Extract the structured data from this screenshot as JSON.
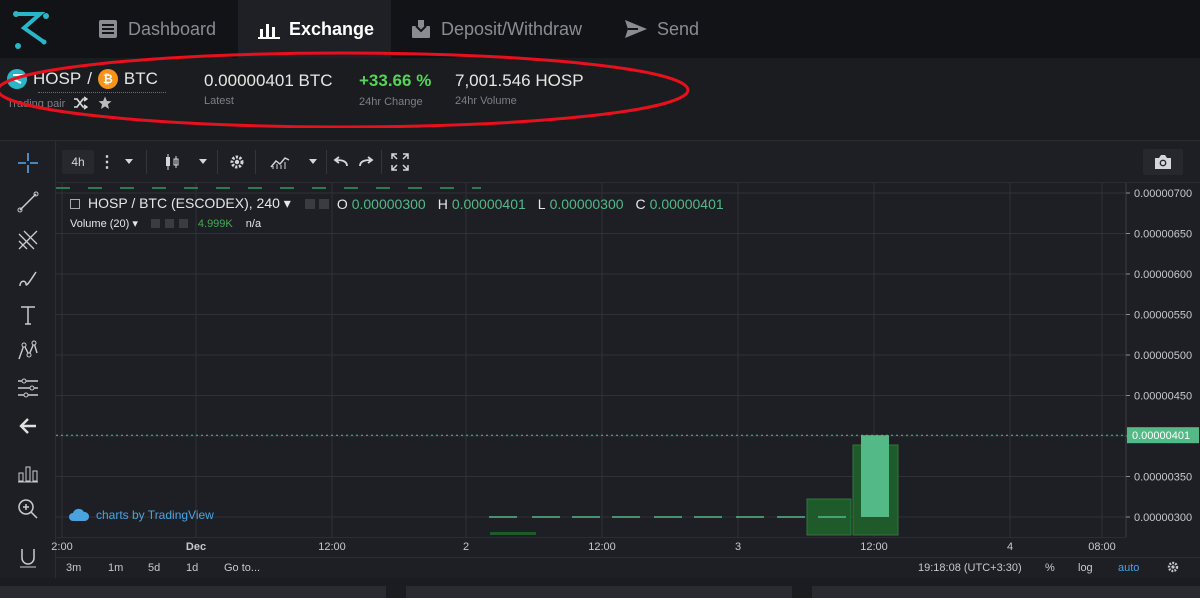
{
  "nav": {
    "items": [
      {
        "label": "Dashboard",
        "icon": "dashboard-icon"
      },
      {
        "label": "Exchange",
        "icon": "bar-chart-icon",
        "active": true
      },
      {
        "label": "Deposit/Withdraw",
        "icon": "wallet-icon"
      },
      {
        "label": "Send",
        "icon": "paper-plane-icon"
      }
    ]
  },
  "pair": {
    "base": "HOSP",
    "slash": "/",
    "quote": "BTC",
    "label": "Trading pair",
    "latest": "0.00000401 BTC",
    "latest_label": "Latest",
    "change": "+33.66 %",
    "change_label": "24hr Change",
    "volume": "7,001.546 HOSP",
    "volume_label": "24hr Volume",
    "quote_icon_glyph": "₿"
  },
  "toolbar": {
    "interval": "4h",
    "more": "⋮"
  },
  "chart_header": {
    "symbol": "HOSP / BTC (ESCODEX), 240 ▾",
    "o_label": "O",
    "o_value": "0.00000300",
    "h_label": "H",
    "h_value": "0.00000401",
    "l_label": "L",
    "l_value": "0.00000300",
    "c_label": "C",
    "c_value": "0.00000401",
    "volume_label": "Volume (20) ▾",
    "volume_value": "4.999K",
    "volume_na": "n/a",
    "watermark": "charts by TradingView"
  },
  "chart_data": {
    "type": "candlestick",
    "y_ticks": [
      "0.00000700",
      "0.00000650",
      "0.00000600",
      "0.00000550",
      "0.00000500",
      "0.00000450",
      "0.00000400",
      "0.00000350",
      "0.00000300"
    ],
    "ylim": [
      2.85e-06,
      7.1e-06
    ],
    "last_price_label": "0.00000401",
    "last_price": 4.01e-06,
    "x_ticks": [
      "2:00",
      "Dec",
      "12:00",
      "2",
      "12:00",
      "3",
      "12:00",
      "4",
      "08:00"
    ],
    "candles_flat_value": 3e-06,
    "big_candle": {
      "open": 3e-06,
      "high": 4.01e-06,
      "low": 3e-06,
      "close": 4.01e-06
    },
    "colors": {
      "up": "#53b987",
      "grid": "#2f3138",
      "volume": "#1f5a2a"
    }
  },
  "bottom": {
    "ranges": [
      "3m",
      "1m",
      "5d",
      "1d",
      "Go to..."
    ],
    "time": "19:18:08 (UTC+3:30)",
    "pct": "%",
    "log": "log",
    "auto": "auto"
  },
  "colors": {
    "accent_green": "#56d356",
    "accent_red": "#e8101c",
    "btc_orange": "#f7931a",
    "hosp_teal": "#2bb5c9",
    "link_blue": "#4aa3e0"
  }
}
